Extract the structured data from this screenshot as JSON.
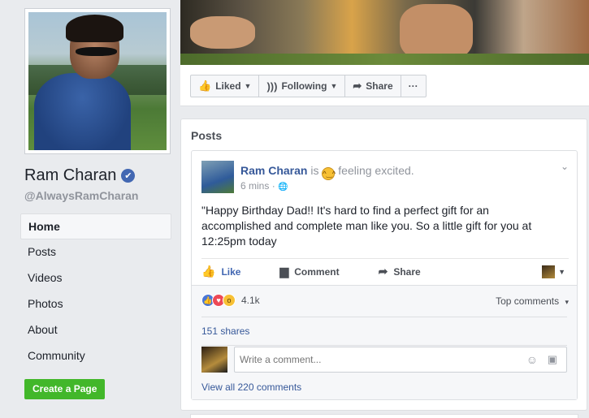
{
  "profile": {
    "name": "Ram Charan",
    "handle": "@AlwaysRamCharan"
  },
  "nav": {
    "items": [
      {
        "label": "Home",
        "active": true
      },
      {
        "label": "Posts"
      },
      {
        "label": "Videos"
      },
      {
        "label": "Photos"
      },
      {
        "label": "About"
      },
      {
        "label": "Community"
      }
    ]
  },
  "create_page_label": "Create a Page",
  "cover_actions": {
    "liked": "Liked",
    "following": "Following",
    "share": "Share",
    "more": "···"
  },
  "posts": {
    "title": "Posts",
    "post": {
      "author": "Ram Charan",
      "is": "is",
      "feeling": "feeling excited.",
      "time": "6 mins",
      "time_sep": "·",
      "text": "\"Happy Birthday Dad!! It's hard to find a perfect gift for an accomplished and complete man like you. So a little gift for you at 12:25pm today",
      "actions": {
        "like": "Like",
        "comment": "Comment",
        "share": "Share"
      },
      "reaction_count": "4.1k",
      "top_comments": "Top comments",
      "shares": "151 shares",
      "comment_placeholder": "Write a comment...",
      "view_all": "View all 220 comments"
    }
  },
  "colors": {
    "brand_blue": "#4267b2",
    "link_blue": "#365899",
    "create_green": "#42b72a",
    "bg": "#e9ebee"
  }
}
